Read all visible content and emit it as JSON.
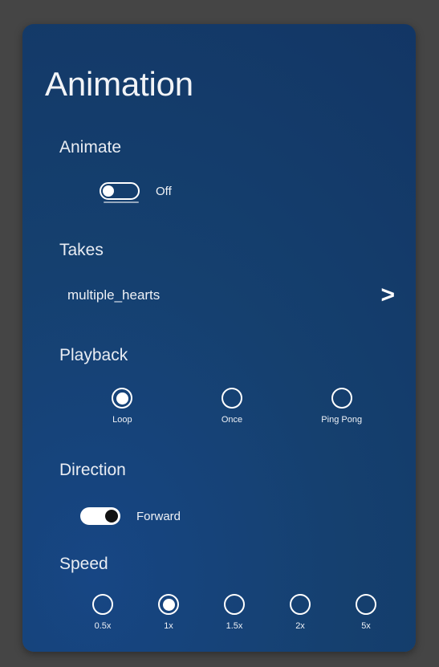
{
  "window": {
    "background_color": "#454545"
  },
  "panel": {
    "title": "Animation",
    "accent_color": "#ffffff",
    "background_color_top": "#123463",
    "background_color_bottom": "#174684"
  },
  "sections": {
    "animate": {
      "label": "Animate",
      "toggle": {
        "state": "off",
        "value_label": "Off"
      }
    },
    "takes": {
      "label": "Takes",
      "selected_value": "multiple_hearts",
      "chevron_icon": "chevron-right-icon",
      "chevron_glyph": ">"
    },
    "playback": {
      "label": "Playback",
      "selected": "Loop",
      "options": [
        {
          "label": "Loop",
          "selected": true
        },
        {
          "label": "Once",
          "selected": false
        },
        {
          "label": "Ping Pong",
          "selected": false
        }
      ]
    },
    "direction": {
      "label": "Direction",
      "toggle": {
        "state": "on",
        "value_label": "Forward"
      }
    },
    "speed": {
      "label": "Speed",
      "selected": "1x",
      "options": [
        {
          "label": "0.5x",
          "selected": false
        },
        {
          "label": "1x",
          "selected": true
        },
        {
          "label": "1.5x",
          "selected": false
        },
        {
          "label": "2x",
          "selected": false
        },
        {
          "label": "5x",
          "selected": false
        }
      ]
    }
  }
}
